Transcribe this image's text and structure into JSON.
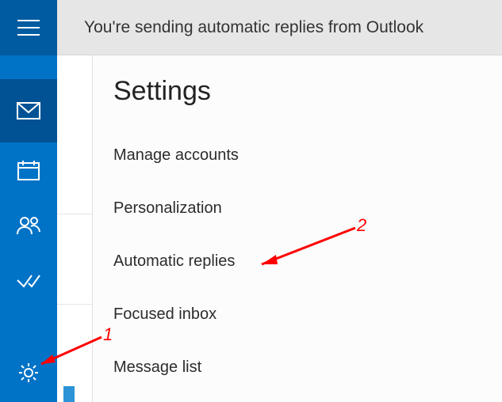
{
  "banner": {
    "text": "You're sending automatic replies from Outlook"
  },
  "rail": {
    "hamburger": "menu-icon",
    "mail": "mail-icon",
    "calendar": "calendar-icon",
    "people": "people-icon",
    "todo": "todo-icon",
    "settings": "gear-icon"
  },
  "settings_panel": {
    "title": "Settings",
    "items": [
      "Manage accounts",
      "Personalization",
      "Automatic replies",
      "Focused inbox",
      "Message list"
    ]
  },
  "annotations": {
    "label1": "1",
    "label2": "2"
  }
}
